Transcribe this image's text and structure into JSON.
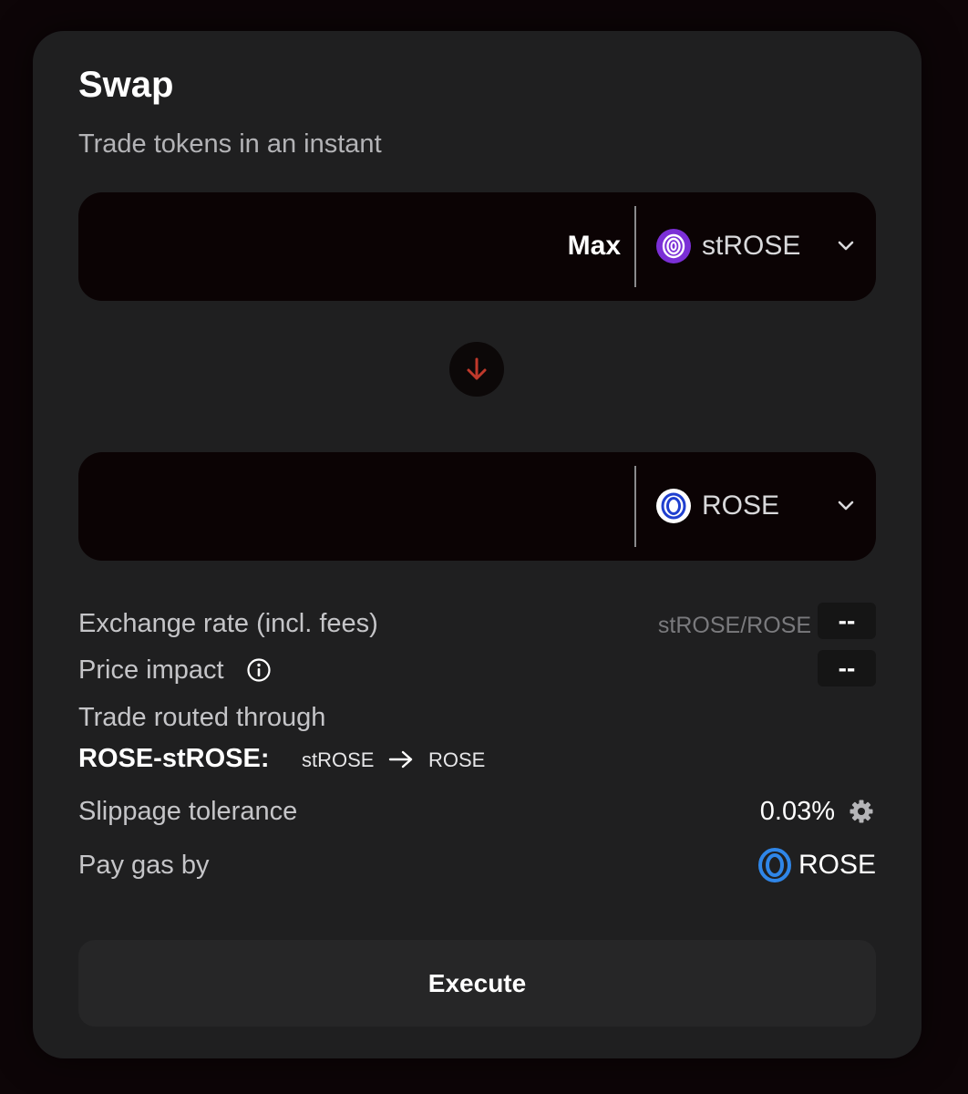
{
  "header": {
    "title": "Swap",
    "subtitle": "Trade tokens in an instant"
  },
  "from_token": {
    "amount_value": "",
    "max_label": "Max",
    "symbol": "stROSE",
    "icon": "strose-token-icon"
  },
  "to_token": {
    "amount_value": "",
    "symbol": "ROSE",
    "icon": "rose-token-icon"
  },
  "details": {
    "exchange_rate_label": "Exchange rate (incl. fees)",
    "exchange_rate_unit": "stROSE/ROSE",
    "exchange_rate_value": "--",
    "price_impact_label": "Price impact",
    "price_impact_value": "--",
    "route_label": "Trade routed through",
    "route_pool": "ROSE-stROSE:",
    "route_from": "stROSE",
    "route_to": "ROSE",
    "slippage_label": "Slippage tolerance",
    "slippage_value": "0.03%",
    "gas_label": "Pay gas by",
    "gas_token": "ROSE"
  },
  "actions": {
    "execute_label": "Execute"
  },
  "colors": {
    "background": "#0d0507",
    "card": "#1f1f20",
    "input_bg": "#0b0304",
    "swap_arrow": "#c0392b",
    "strose_purple": "#7b2fd6",
    "rose_blue": "#1f3fcf",
    "gas_icon_blue": "#2f86e8"
  }
}
